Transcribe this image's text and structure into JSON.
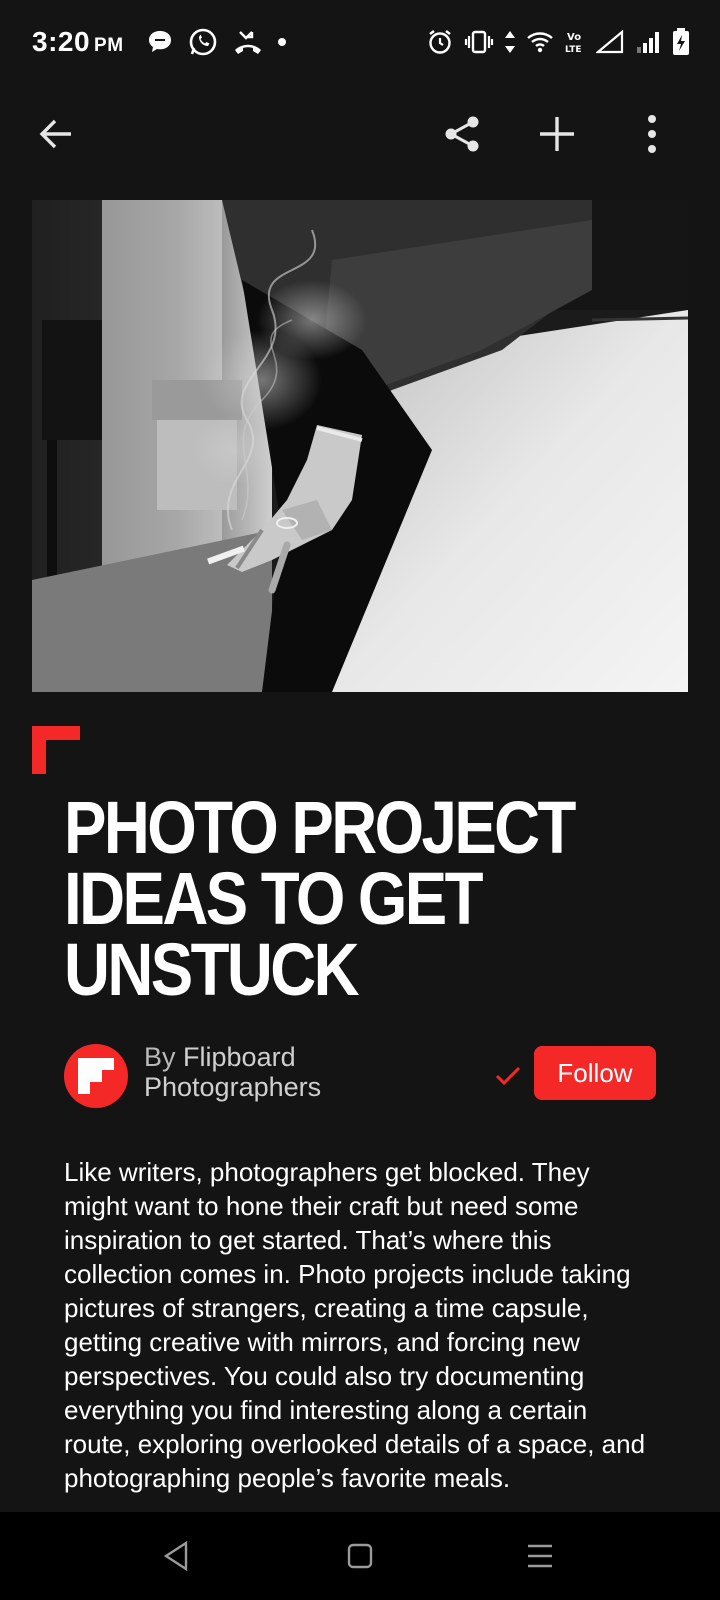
{
  "status_bar": {
    "time": "3:20",
    "ampm": "PM",
    "left_icons": [
      "message-bubble-icon",
      "whatsapp-icon",
      "missed-call-icon",
      "notification-dot-icon"
    ],
    "right_icons": [
      "alarm-icon",
      "vibrate-icon",
      "data-arrows-icon",
      "wifi-icon",
      "volte-icon",
      "signal-empty-icon",
      "signal-icon",
      "battery-charging-icon"
    ],
    "volte_label": "Vo LTE"
  },
  "toolbar": {
    "back": "back-arrow-icon",
    "share": "share-icon",
    "add": "plus-icon",
    "more": "more-vert-icon"
  },
  "article": {
    "headline": "PHOTO PROJECT IDEAS TO GET UNSTUCK",
    "byline_prefix": "By",
    "author_line1": "Flipboard",
    "author_line2": "Photographers",
    "follow_label": "Follow",
    "body": "Like writers, photographers get blocked. They might want to hone their craft but need some inspiration to get started. That’s where this collection comes in. Photo projects include taking pictures of strangers, creating a time capsule, getting creative with mirrors, and forcing new perspectives. You could also try documenting everything you find interesting along a certain route, exploring overlooked details of a space, and photographing people’s favorite meals."
  },
  "colors": {
    "background": "#141414",
    "accent": "#f52828",
    "text": "#ffffff",
    "muted": "#b9b9b9",
    "nav_bg": "#000000"
  },
  "nav_bar": {
    "back": "nav-back-icon",
    "home": "nav-home-icon",
    "recents": "nav-menu-icon"
  }
}
